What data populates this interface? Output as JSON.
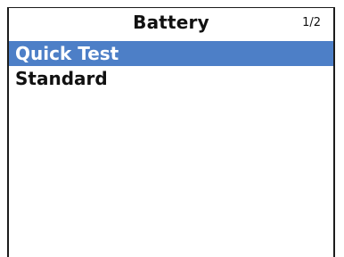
{
  "header": {
    "title": "Battery",
    "page_indicator": "1/2"
  },
  "menu": {
    "items": [
      {
        "label": "Quick Test",
        "selected": true
      },
      {
        "label": "Standard",
        "selected": false
      }
    ]
  },
  "colors": {
    "selection_bg": "#4d7fc7",
    "selection_text": "#ffffff",
    "text": "#111111",
    "background": "#ffffff"
  }
}
